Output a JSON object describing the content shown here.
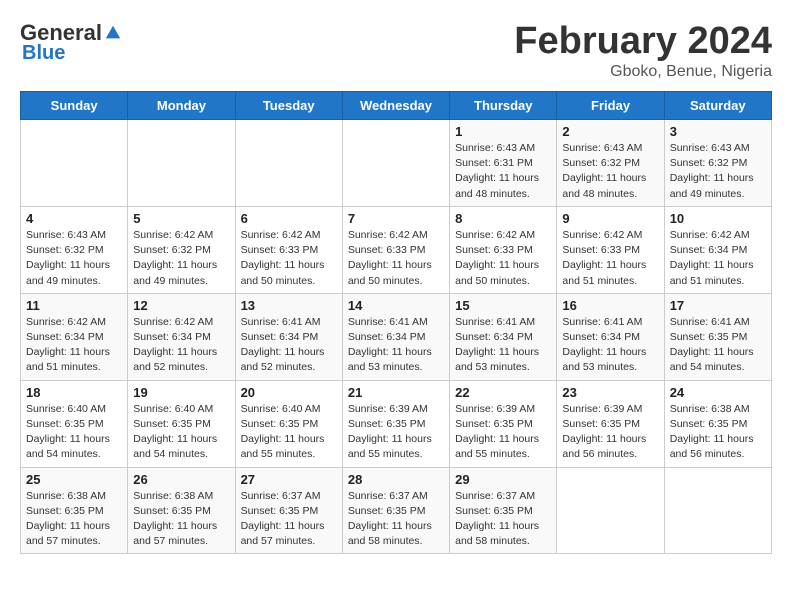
{
  "header": {
    "logo_general": "General",
    "logo_blue": "Blue",
    "title": "February 2024",
    "subtitle": "Gboko, Benue, Nigeria"
  },
  "columns": [
    "Sunday",
    "Monday",
    "Tuesday",
    "Wednesday",
    "Thursday",
    "Friday",
    "Saturday"
  ],
  "weeks": [
    [
      {
        "day": "",
        "info": ""
      },
      {
        "day": "",
        "info": ""
      },
      {
        "day": "",
        "info": ""
      },
      {
        "day": "",
        "info": ""
      },
      {
        "day": "1",
        "info": "Sunrise: 6:43 AM\nSunset: 6:31 PM\nDaylight: 11 hours\nand 48 minutes."
      },
      {
        "day": "2",
        "info": "Sunrise: 6:43 AM\nSunset: 6:32 PM\nDaylight: 11 hours\nand 48 minutes."
      },
      {
        "day": "3",
        "info": "Sunrise: 6:43 AM\nSunset: 6:32 PM\nDaylight: 11 hours\nand 49 minutes."
      }
    ],
    [
      {
        "day": "4",
        "info": "Sunrise: 6:43 AM\nSunset: 6:32 PM\nDaylight: 11 hours\nand 49 minutes."
      },
      {
        "day": "5",
        "info": "Sunrise: 6:42 AM\nSunset: 6:32 PM\nDaylight: 11 hours\nand 49 minutes."
      },
      {
        "day": "6",
        "info": "Sunrise: 6:42 AM\nSunset: 6:33 PM\nDaylight: 11 hours\nand 50 minutes."
      },
      {
        "day": "7",
        "info": "Sunrise: 6:42 AM\nSunset: 6:33 PM\nDaylight: 11 hours\nand 50 minutes."
      },
      {
        "day": "8",
        "info": "Sunrise: 6:42 AM\nSunset: 6:33 PM\nDaylight: 11 hours\nand 50 minutes."
      },
      {
        "day": "9",
        "info": "Sunrise: 6:42 AM\nSunset: 6:33 PM\nDaylight: 11 hours\nand 51 minutes."
      },
      {
        "day": "10",
        "info": "Sunrise: 6:42 AM\nSunset: 6:34 PM\nDaylight: 11 hours\nand 51 minutes."
      }
    ],
    [
      {
        "day": "11",
        "info": "Sunrise: 6:42 AM\nSunset: 6:34 PM\nDaylight: 11 hours\nand 51 minutes."
      },
      {
        "day": "12",
        "info": "Sunrise: 6:42 AM\nSunset: 6:34 PM\nDaylight: 11 hours\nand 52 minutes."
      },
      {
        "day": "13",
        "info": "Sunrise: 6:41 AM\nSunset: 6:34 PM\nDaylight: 11 hours\nand 52 minutes."
      },
      {
        "day": "14",
        "info": "Sunrise: 6:41 AM\nSunset: 6:34 PM\nDaylight: 11 hours\nand 53 minutes."
      },
      {
        "day": "15",
        "info": "Sunrise: 6:41 AM\nSunset: 6:34 PM\nDaylight: 11 hours\nand 53 minutes."
      },
      {
        "day": "16",
        "info": "Sunrise: 6:41 AM\nSunset: 6:34 PM\nDaylight: 11 hours\nand 53 minutes."
      },
      {
        "day": "17",
        "info": "Sunrise: 6:41 AM\nSunset: 6:35 PM\nDaylight: 11 hours\nand 54 minutes."
      }
    ],
    [
      {
        "day": "18",
        "info": "Sunrise: 6:40 AM\nSunset: 6:35 PM\nDaylight: 11 hours\nand 54 minutes."
      },
      {
        "day": "19",
        "info": "Sunrise: 6:40 AM\nSunset: 6:35 PM\nDaylight: 11 hours\nand 54 minutes."
      },
      {
        "day": "20",
        "info": "Sunrise: 6:40 AM\nSunset: 6:35 PM\nDaylight: 11 hours\nand 55 minutes."
      },
      {
        "day": "21",
        "info": "Sunrise: 6:39 AM\nSunset: 6:35 PM\nDaylight: 11 hours\nand 55 minutes."
      },
      {
        "day": "22",
        "info": "Sunrise: 6:39 AM\nSunset: 6:35 PM\nDaylight: 11 hours\nand 55 minutes."
      },
      {
        "day": "23",
        "info": "Sunrise: 6:39 AM\nSunset: 6:35 PM\nDaylight: 11 hours\nand 56 minutes."
      },
      {
        "day": "24",
        "info": "Sunrise: 6:38 AM\nSunset: 6:35 PM\nDaylight: 11 hours\nand 56 minutes."
      }
    ],
    [
      {
        "day": "25",
        "info": "Sunrise: 6:38 AM\nSunset: 6:35 PM\nDaylight: 11 hours\nand 57 minutes."
      },
      {
        "day": "26",
        "info": "Sunrise: 6:38 AM\nSunset: 6:35 PM\nDaylight: 11 hours\nand 57 minutes."
      },
      {
        "day": "27",
        "info": "Sunrise: 6:37 AM\nSunset: 6:35 PM\nDaylight: 11 hours\nand 57 minutes."
      },
      {
        "day": "28",
        "info": "Sunrise: 6:37 AM\nSunset: 6:35 PM\nDaylight: 11 hours\nand 58 minutes."
      },
      {
        "day": "29",
        "info": "Sunrise: 6:37 AM\nSunset: 6:35 PM\nDaylight: 11 hours\nand 58 minutes."
      },
      {
        "day": "",
        "info": ""
      },
      {
        "day": "",
        "info": ""
      }
    ]
  ]
}
